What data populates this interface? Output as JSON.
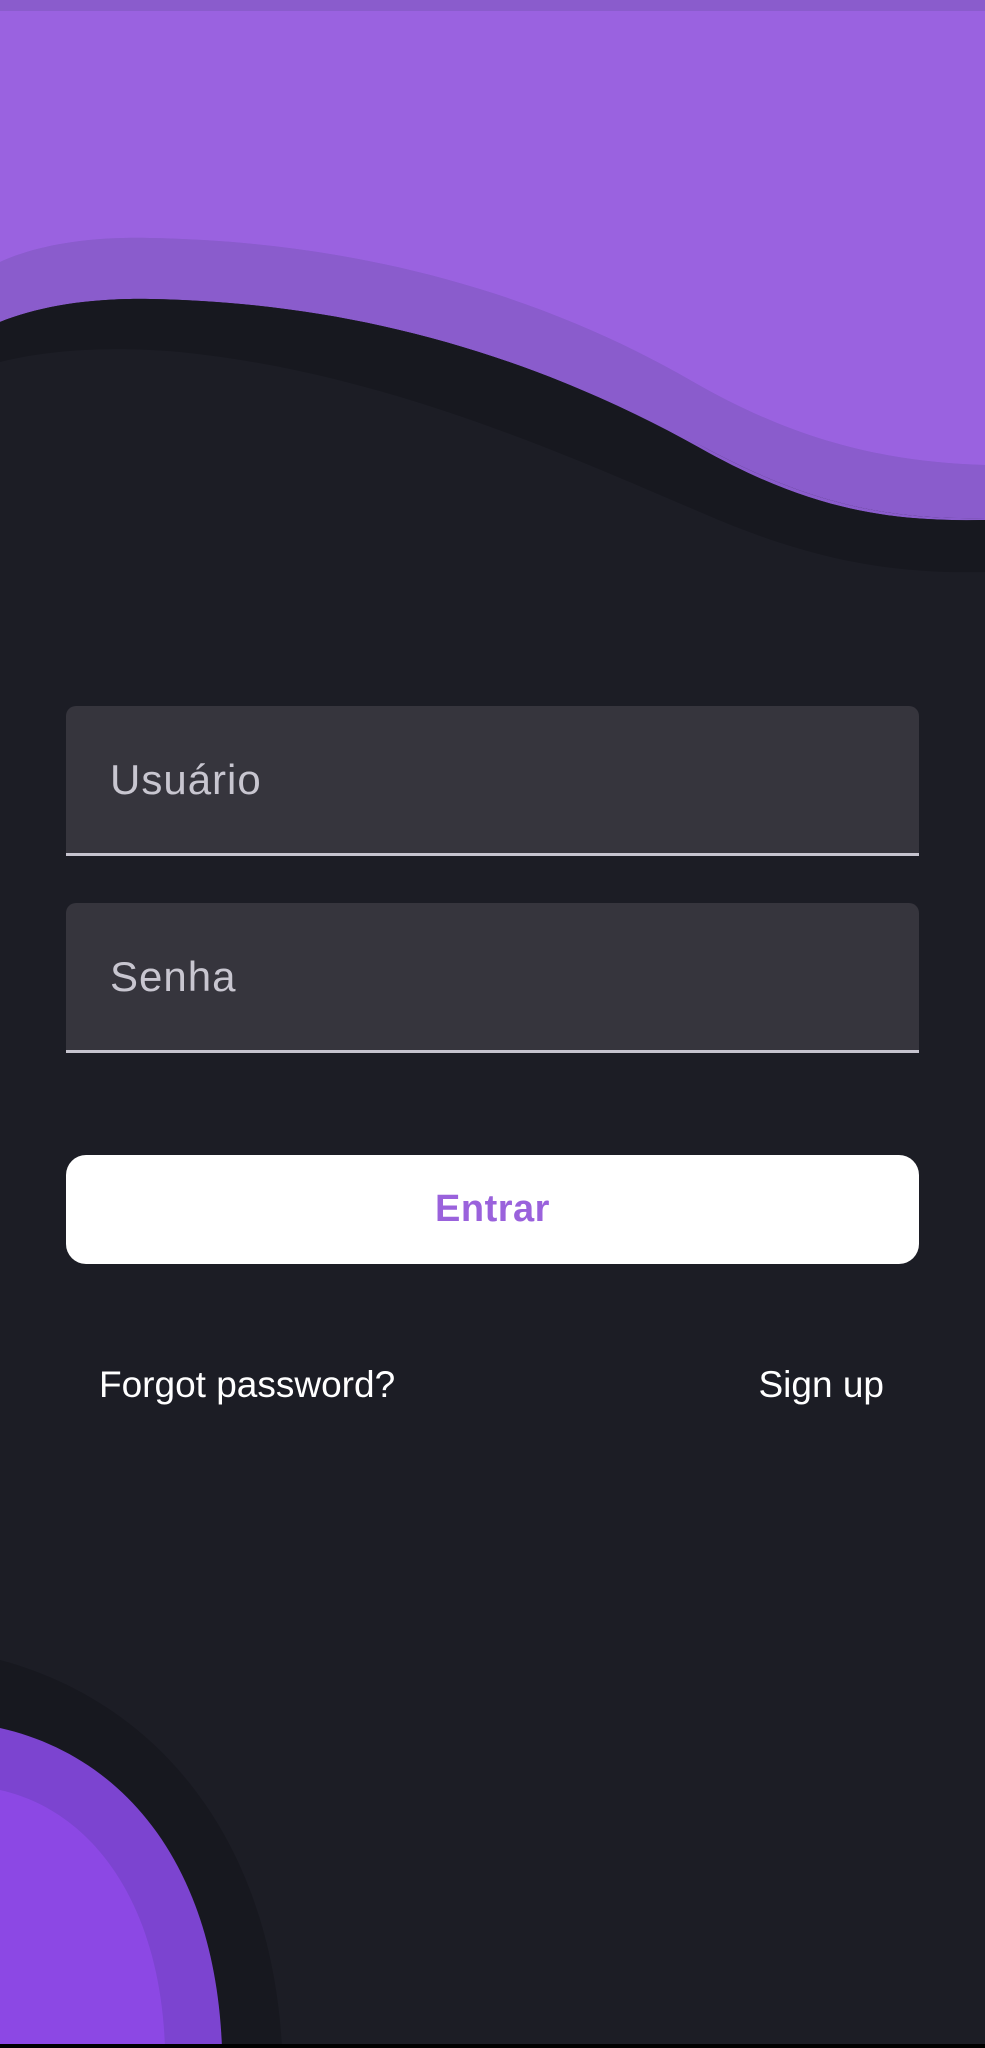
{
  "colors": {
    "background": "#1c1d25",
    "accent_purple": "#9a62e0",
    "accent_purple_shadow": "#8a5ccc",
    "accent_bottom": "#8c48e4",
    "field_background": "#36353d",
    "button_background": "#ffffff",
    "button_text": "#9a62dc",
    "link_text": "#ffffff"
  },
  "login_form": {
    "username_placeholder": "Usuário",
    "password_placeholder": "Senha",
    "submit_label": "Entrar"
  },
  "links": {
    "forgot_password": "Forgot password?",
    "sign_up": "Sign up"
  }
}
